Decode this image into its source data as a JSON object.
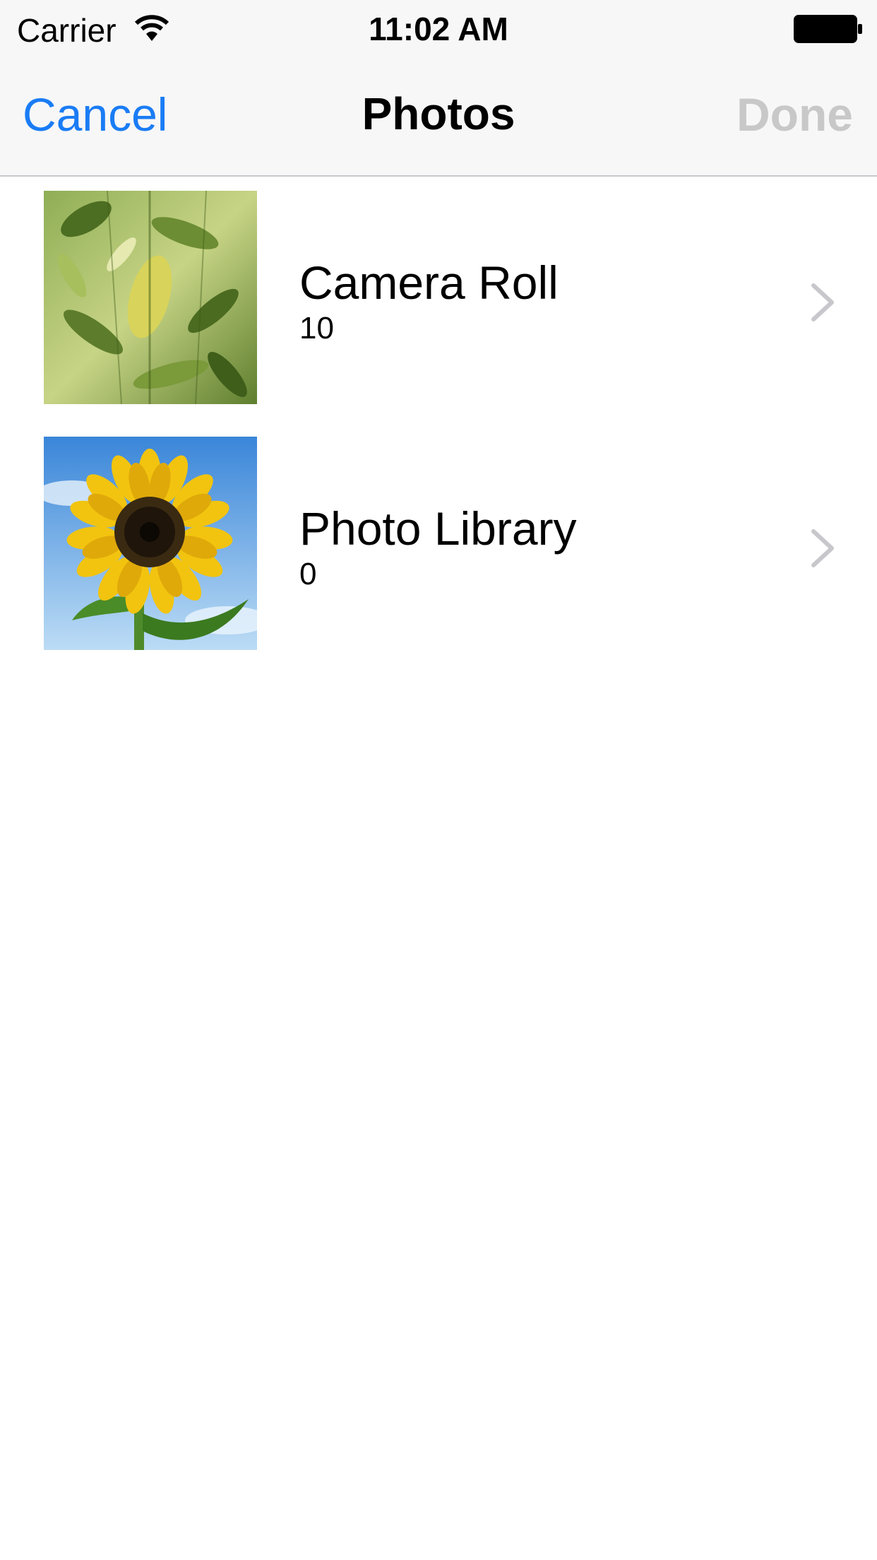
{
  "status_bar": {
    "carrier": "Carrier",
    "time": "11:02 AM"
  },
  "nav": {
    "cancel_label": "Cancel",
    "title": "Photos",
    "done_label": "Done"
  },
  "albums": [
    {
      "title": "Camera Roll",
      "count": "10",
      "thumbnail": "leaves-photo"
    },
    {
      "title": "Photo Library",
      "count": "0",
      "thumbnail": "sunflower-photo"
    }
  ],
  "colors": {
    "accent": "#1a7cf5",
    "disabled": "#c8c8c8",
    "chevron": "#c7c7cc"
  }
}
